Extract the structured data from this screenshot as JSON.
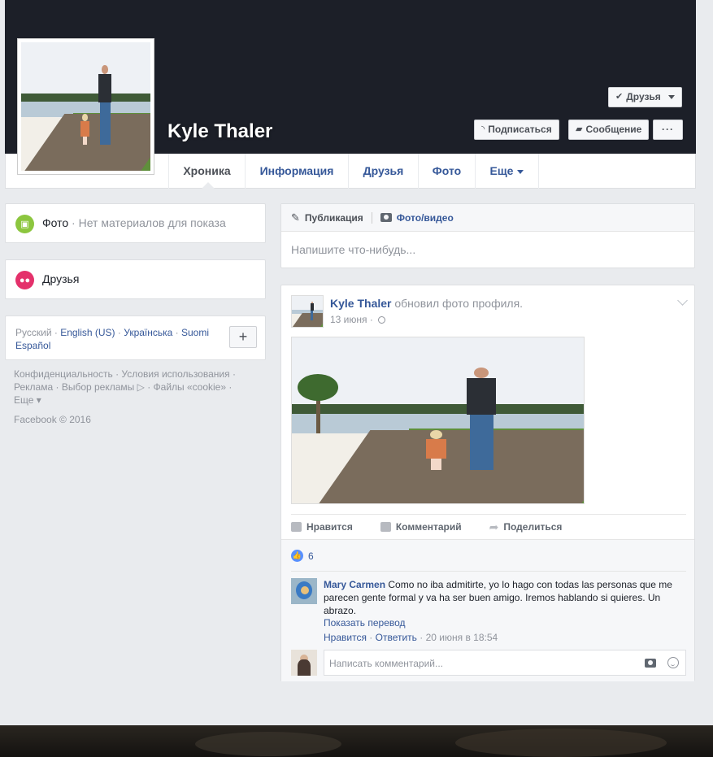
{
  "profile": {
    "name": "Kyle Thaler"
  },
  "header_buttons": {
    "friends": "Друзья",
    "subscribe": "Подписаться",
    "message": "Сообщение",
    "more": "···"
  },
  "nav": {
    "tabs": [
      {
        "label": "Хроника",
        "active": true
      },
      {
        "label": "Информация"
      },
      {
        "label": "Друзья"
      },
      {
        "label": "Фото"
      },
      {
        "label": "Еще"
      }
    ]
  },
  "sidebar": {
    "photos_title": "Фото",
    "photos_sub": " · Нет материалов для показа",
    "friends_title": "Друзья"
  },
  "languages": {
    "current": "Русский",
    "options": [
      "English (US)",
      "Українська",
      "Suomi",
      "Español"
    ],
    "add": "+"
  },
  "footer": {
    "links": [
      "Конфиденциальность",
      "Условия использования",
      "Реклама",
      "Выбор рекламы",
      "Файлы «cookie»",
      "Еще"
    ],
    "copyright": "Facebook © 2016"
  },
  "composer": {
    "tab_post": "Публикация",
    "tab_photo": "Фото/видео",
    "placeholder": "Напишите что-нибудь..."
  },
  "post": {
    "author": "Kyle Thaler",
    "action_text": " обновил фото профиля.",
    "date": "13 июня",
    "actions": {
      "like": "Нравится",
      "comment": "Комментарий",
      "share": "Поделиться"
    },
    "likes_count": "6",
    "comment": {
      "author": "Mary Carmen",
      "text": " Como no iba admitirte, yo lo hago con todas las personas que me parecen gente formal y va ha ser buen amigo. Iremos hablando si quieres. Un abrazo.",
      "translate": "Показать перевод",
      "like": "Нравится",
      "reply": "Ответить",
      "time": "20 июня в 18:54"
    },
    "comment_placeholder": "Написать комментарий..."
  },
  "colors": {
    "cover": "#1c1f28",
    "link": "#365899",
    "photos_icon": "#8cc63f",
    "friends_icon": "#e4316b",
    "like_badge": "#5890ff"
  }
}
